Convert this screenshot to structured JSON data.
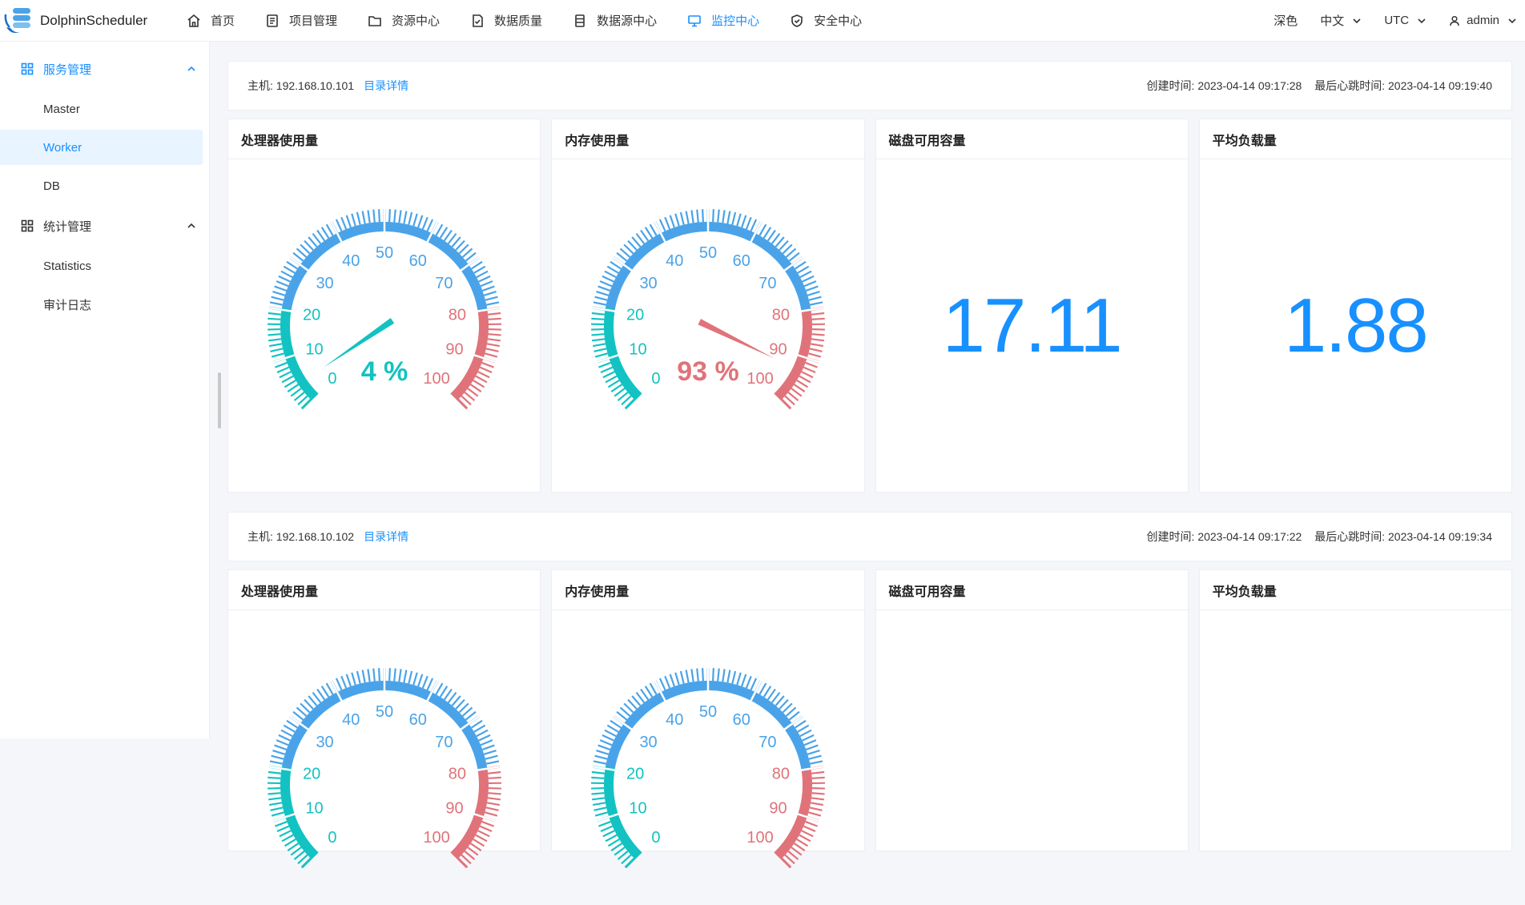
{
  "app": {
    "name": "DolphinScheduler",
    "nav": [
      {
        "key": "home",
        "label": "首页",
        "icon": "home-icon"
      },
      {
        "key": "project",
        "label": "项目管理",
        "icon": "project-icon"
      },
      {
        "key": "resource",
        "label": "资源中心",
        "icon": "folder-icon"
      },
      {
        "key": "quality",
        "label": "数据质量",
        "icon": "document-check-icon"
      },
      {
        "key": "datasource",
        "label": "数据源中心",
        "icon": "database-icon"
      },
      {
        "key": "monitor",
        "label": "监控中心",
        "icon": "monitor-icon",
        "active": true
      },
      {
        "key": "security",
        "label": "安全中心",
        "icon": "shield-icon"
      }
    ],
    "theme": "深色",
    "language": "中文",
    "timezone": "UTC",
    "user": "admin"
  },
  "sidebar": {
    "groups": [
      {
        "label": "服务管理",
        "items": [
          "Master",
          "Worker",
          "DB"
        ],
        "active_item": "Worker"
      },
      {
        "label": "统计管理",
        "items": [
          "Statistics",
          "审计日志"
        ]
      }
    ]
  },
  "colors": {
    "accent": "#1890ff",
    "gauge_low": "#13c2c2",
    "gauge_mid": "#4aa3e8",
    "gauge_high": "#e0737a"
  },
  "workers": [
    {
      "host_label": "主机: 192.168.10.101",
      "dir_link": "目录详情",
      "created": "创建时间: 2023-04-14 09:17:28",
      "heartbeat": "最后心跳时间: 2023-04-14 09:19:40",
      "cpu_title": "处理器使用量",
      "cpu_percent": 4,
      "cpu_text": "4 %",
      "mem_title": "内存使用量",
      "mem_percent": 93,
      "mem_text": "93 %",
      "disk_title": "磁盘可用容量",
      "disk_value": "17.11",
      "load_title": "平均负载量",
      "load_value": "1.88"
    },
    {
      "host_label": "主机: 192.168.10.102",
      "dir_link": "目录详情",
      "created": "创建时间: 2023-04-14 09:17:22",
      "heartbeat": "最后心跳时间: 2023-04-14 09:19:34",
      "cpu_title": "处理器使用量",
      "mem_title": "内存使用量",
      "disk_title": "磁盘可用容量",
      "load_title": "平均负载量"
    }
  ]
}
